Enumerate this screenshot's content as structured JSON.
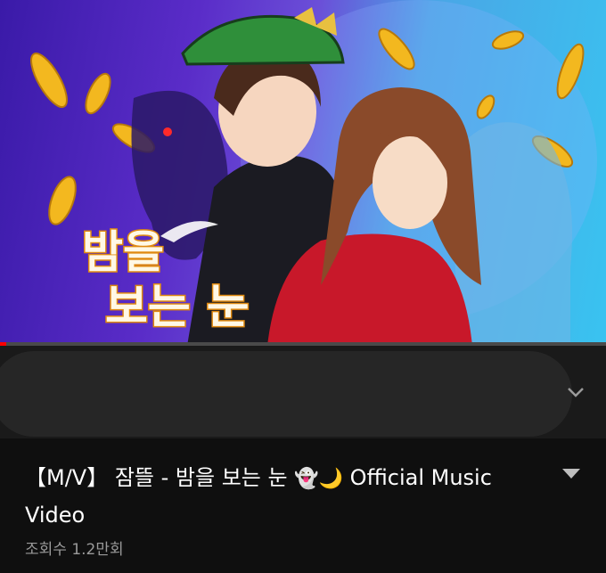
{
  "video": {
    "thumbnail_logo_text_line1": "밤을",
    "thumbnail_logo_text_line2": "보는 눈",
    "progress_fraction": 0.01,
    "progress_color": "#ff0000"
  },
  "details": {
    "title_part1": "【M/V】 잠뜰 - 밤을 보는 눈",
    "title_emoji_ghost": "👻",
    "title_emoji_moon": "🌙",
    "title_part2": "Official Music Video",
    "views": "조회수 1.2만회"
  },
  "icons": {
    "expand": "chevron-down-icon",
    "more": "caret-down-icon"
  }
}
